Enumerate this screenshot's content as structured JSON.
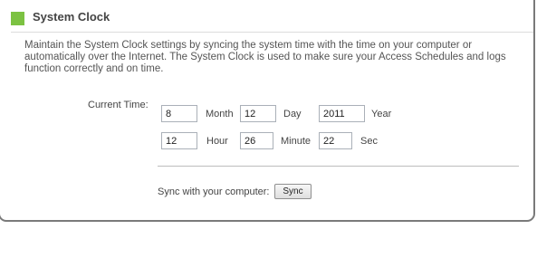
{
  "section": {
    "title": "System Clock",
    "description": "Maintain the System Clock settings by syncing the system time with the time on your computer or automatically over the Internet. The System Clock is used to make sure your Access Schedules and logs function correctly and on time.",
    "accent_color": "#7cc242",
    "icon": "green-square-icon"
  },
  "clock": {
    "current_time_label": "Current Time:",
    "month": {
      "value": "8",
      "label": "Month"
    },
    "day": {
      "value": "12",
      "label": "Day"
    },
    "year": {
      "value": "2011",
      "label": "Year"
    },
    "hour": {
      "value": "12",
      "label": "Hour"
    },
    "minute": {
      "value": "26",
      "label": "Minute"
    },
    "second": {
      "value": "22",
      "label": "Sec"
    }
  },
  "sync": {
    "label": "Sync with your computer:",
    "button_label": "Sync"
  }
}
